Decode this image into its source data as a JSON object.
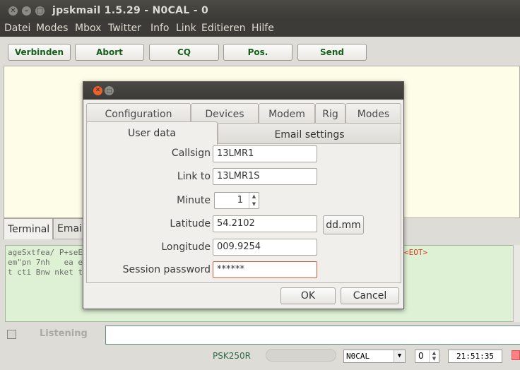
{
  "window": {
    "title": "jpskmail 1.5.29 - N0CAL - 0"
  },
  "menu": [
    "Datei",
    "Modes",
    "Mbox",
    "Twitter",
    "Info",
    "Link",
    "Editieren",
    "Hilfe"
  ],
  "toolbar": [
    "Verbinden",
    "Abort",
    "CQ",
    "Pos.",
    "Send"
  ],
  "bottom_tabs": [
    "Terminal",
    "Email"
  ],
  "terminal": {
    "lines": [
      "ageSxtfea/ P+seE",
      "em\"pn 7nh   ea e",
      "t cti Bnw nket t"
    ],
    "eot_marker": "<EOT>"
  },
  "listening_label": "Listening",
  "status": {
    "mode": "PSK250R",
    "callsign": "N0CAL",
    "channel": "0",
    "time": "21:51:35"
  },
  "dialog": {
    "top_tabs": [
      "Configuration",
      "Devices",
      "Modem",
      "Rig",
      "Modes"
    ],
    "sub_tabs": [
      "User data",
      "Email settings"
    ],
    "fields": {
      "callsign_label": "Callsign",
      "callsign_value": "13LMR1",
      "linkto_label": "Link to",
      "linkto_value": "13LMR1S",
      "minute_label": "Minute",
      "minute_value": "1",
      "latitude_label": "Latitude",
      "latitude_value": "54.2102",
      "longitude_label": "Longitude",
      "longitude_value": "009.9254",
      "password_label": "Session password",
      "password_value": "******"
    },
    "format_button": "dd.mm",
    "ok_button": "OK",
    "cancel_button": "Cancel"
  }
}
